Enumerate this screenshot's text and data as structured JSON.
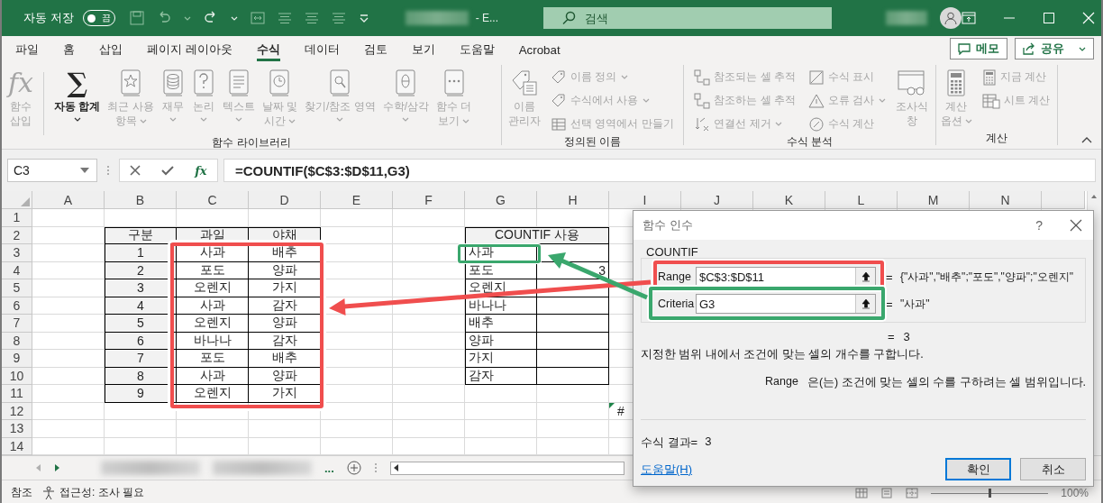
{
  "title_bar": {
    "autosave_label": "자동 저장",
    "autosave": {
      "label": "끔",
      "on": false
    },
    "title": "- E...",
    "search": {
      "placeholder": "검색"
    }
  },
  "tabs": [
    {
      "label": "파일",
      "selected": false
    },
    {
      "label": "홈",
      "selected": false
    },
    {
      "label": "삽입",
      "selected": false
    },
    {
      "label": "페이지 레이아웃",
      "selected": false
    },
    {
      "label": "수식",
      "selected": true
    },
    {
      "label": "데이터",
      "selected": false
    },
    {
      "label": "검토",
      "selected": false
    },
    {
      "label": "보기",
      "selected": false
    },
    {
      "label": "도움말",
      "selected": false
    },
    {
      "label": "Acrobat",
      "selected": false
    }
  ],
  "top_buttons": [
    {
      "label": "메모"
    },
    {
      "label": "공유"
    }
  ],
  "ribbon": {
    "groups": [
      {
        "label": "함수 라이브러리",
        "items": [
          {
            "kind": "large",
            "glyph": "fx",
            "label": "함수\n삽입",
            "disabled": true,
            "dropdown": false
          },
          {
            "kind": "large",
            "glyph": "∑",
            "label": "자동 합계",
            "disabled": false,
            "dropdown": true
          },
          {
            "kind": "large",
            "label": "최근 사용\n항목",
            "disabled": true,
            "dropdown": true
          },
          {
            "kind": "large",
            "label": "재무",
            "disabled": true,
            "dropdown": true
          },
          {
            "kind": "large",
            "label": "논리",
            "disabled": true,
            "dropdown": true
          },
          {
            "kind": "large",
            "label": "텍스트",
            "disabled": true,
            "dropdown": true
          },
          {
            "kind": "large",
            "label": "날짜 및\n시간",
            "disabled": true,
            "dropdown": true
          },
          {
            "kind": "large",
            "label": "찾기/참조 영역",
            "disabled": true,
            "dropdown": true
          },
          {
            "kind": "large",
            "label": "수학/삼각",
            "disabled": true,
            "dropdown": true
          },
          {
            "kind": "large",
            "label": "함수 더\n보기",
            "disabled": true,
            "dropdown": true
          }
        ]
      },
      {
        "label": "정의된 이름",
        "items": [
          {
            "kind": "large",
            "label": "이름\n관리자",
            "disabled": true,
            "dropdown": false
          },
          {
            "kind": "small",
            "label": "이름 정의",
            "disabled": true,
            "dropdown": true
          },
          {
            "kind": "small",
            "label": "수식에서 사용",
            "disabled": true,
            "dropdown": true
          },
          {
            "kind": "small",
            "label": "선택 영역에서 만들기",
            "disabled": true,
            "dropdown": false
          }
        ]
      },
      {
        "label": "수식 분석",
        "items": [
          {
            "kind": "small",
            "label": "참조되는 셀 추적",
            "disabled": true,
            "dropdown": false
          },
          {
            "kind": "small",
            "label": "참조하는 셀 추적",
            "disabled": true,
            "dropdown": false
          },
          {
            "kind": "small",
            "label": "연결선 제거",
            "disabled": true,
            "dropdown": true
          },
          {
            "kind": "small",
            "label": "수식 표시",
            "disabled": true,
            "dropdown": false
          },
          {
            "kind": "small",
            "label": "오류 검사",
            "disabled": true,
            "dropdown": true
          },
          {
            "kind": "small",
            "label": "수식 계산",
            "disabled": true,
            "dropdown": false
          },
          {
            "kind": "large",
            "label": "조사식\n창",
            "disabled": true,
            "dropdown": false
          }
        ]
      },
      {
        "label": "계산",
        "items": [
          {
            "kind": "large",
            "label": "계산\n옵션",
            "disabled": true,
            "dropdown": true
          },
          {
            "kind": "small",
            "label": "지금 계산",
            "disabled": true,
            "dropdown": false
          },
          {
            "kind": "small",
            "label": "시트 계산",
            "disabled": true,
            "dropdown": false
          }
        ]
      }
    ]
  },
  "formula_bar": {
    "name_box": "C3",
    "fx": "fx",
    "formula": "=COUNTIF($C$3:$D$11,G3)"
  },
  "sheet": {
    "columns": [
      "A",
      "B",
      "C",
      "D",
      "E",
      "F",
      "G",
      "H",
      "I",
      "J",
      "K",
      "L",
      "M",
      "N"
    ],
    "rows": [
      {
        "header": "1"
      },
      {
        "header": "2",
        "cells": {
          "B": {
            "text": "구분",
            "kind": "head"
          },
          "C": {
            "text": "과일",
            "kind": "head"
          },
          "D": {
            "text": "야채",
            "kind": "head"
          },
          "G": {
            "text": "COUNTIF 사용",
            "kind": "merged-head"
          }
        }
      },
      {
        "header": "3",
        "cells": {
          "B": {
            "text": "1",
            "kind": "head"
          },
          "C": {
            "text": "사과",
            "kind": "center"
          },
          "D": {
            "text": "배추",
            "kind": "center"
          },
          "G": {
            "text": "사과",
            "kind": "left"
          }
        }
      },
      {
        "header": "4",
        "cells": {
          "B": {
            "text": "2",
            "kind": "head"
          },
          "C": {
            "text": "포도",
            "kind": "center"
          },
          "D": {
            "text": "양파",
            "kind": "center"
          },
          "G": {
            "text": "포도",
            "kind": "left"
          },
          "H": {
            "text": "3",
            "kind": "right"
          }
        }
      },
      {
        "header": "5",
        "cells": {
          "B": {
            "text": "3",
            "kind": "head"
          },
          "C": {
            "text": "오렌지",
            "kind": "center"
          },
          "D": {
            "text": "가지",
            "kind": "center"
          },
          "G": {
            "text": "오렌지",
            "kind": "left"
          }
        }
      },
      {
        "header": "6",
        "cells": {
          "B": {
            "text": "4",
            "kind": "head"
          },
          "C": {
            "text": "사과",
            "kind": "center"
          },
          "D": {
            "text": "감자",
            "kind": "center"
          },
          "G": {
            "text": "바나나",
            "kind": "left"
          }
        }
      },
      {
        "header": "7",
        "cells": {
          "B": {
            "text": "5",
            "kind": "head"
          },
          "C": {
            "text": "오렌지",
            "kind": "center"
          },
          "D": {
            "text": "양파",
            "kind": "center"
          },
          "G": {
            "text": "배추",
            "kind": "left"
          }
        }
      },
      {
        "header": "8",
        "cells": {
          "B": {
            "text": "6",
            "kind": "head"
          },
          "C": {
            "text": "바나나",
            "kind": "center"
          },
          "D": {
            "text": "감자",
            "kind": "center"
          },
          "G": {
            "text": "양파",
            "kind": "left"
          }
        }
      },
      {
        "header": "9",
        "cells": {
          "B": {
            "text": "7",
            "kind": "head"
          },
          "C": {
            "text": "포도",
            "kind": "center"
          },
          "D": {
            "text": "배추",
            "kind": "center"
          },
          "G": {
            "text": "가지",
            "kind": "left"
          }
        }
      },
      {
        "header": "10",
        "cells": {
          "B": {
            "text": "8",
            "kind": "head"
          },
          "C": {
            "text": "사과",
            "kind": "center"
          },
          "D": {
            "text": "양파",
            "kind": "center"
          },
          "G": {
            "text": "감자",
            "kind": "left"
          }
        }
      },
      {
        "header": "11",
        "cells": {
          "B": {
            "text": "9",
            "kind": "head"
          },
          "C": {
            "text": "오렌지",
            "kind": "center"
          },
          "D": {
            "text": "가지",
            "kind": "center"
          }
        }
      },
      {
        "header": "12",
        "cells": {
          "I": {
            "text": "#",
            "kind": "error"
          }
        }
      },
      {
        "header": "13"
      },
      {
        "header": "14"
      }
    ]
  },
  "dialog": {
    "title": "함수 인수",
    "help_glyph": "?",
    "function": "COUNTIF",
    "args": [
      {
        "label": "Range",
        "value": "$C$3:$D$11",
        "equals": "=",
        "preview": "{\"사과\",\"배추\";\"포도\",\"양파\";\"오렌지\""
      },
      {
        "label": "Criteria",
        "value": "G3",
        "equals": "=",
        "preview": "\"사과\""
      }
    ],
    "result_line": {
      "equals": "=",
      "value": "3"
    },
    "description": "지정한 범위 내에서 조건에 맞는 셀의 개수를 구합니다.",
    "arg_help": {
      "name": "Range",
      "text": "은(는) 조건에 맞는 셀의 수를 구하려는 셀 범위입니다."
    },
    "formula_result": {
      "label": "수식 결과=",
      "value": "3"
    },
    "help_link": "도움말(H)",
    "buttons": [
      {
        "label": "확인",
        "default": true
      },
      {
        "label": "취소",
        "default": false
      }
    ]
  },
  "sheet_tabs": {
    "more": "..."
  },
  "status_bar": {
    "mode": "참조",
    "accessibility": "접근성: 조사 필요",
    "zoom_slider": {
      "level": 0.5
    },
    "zoom": "100%"
  }
}
